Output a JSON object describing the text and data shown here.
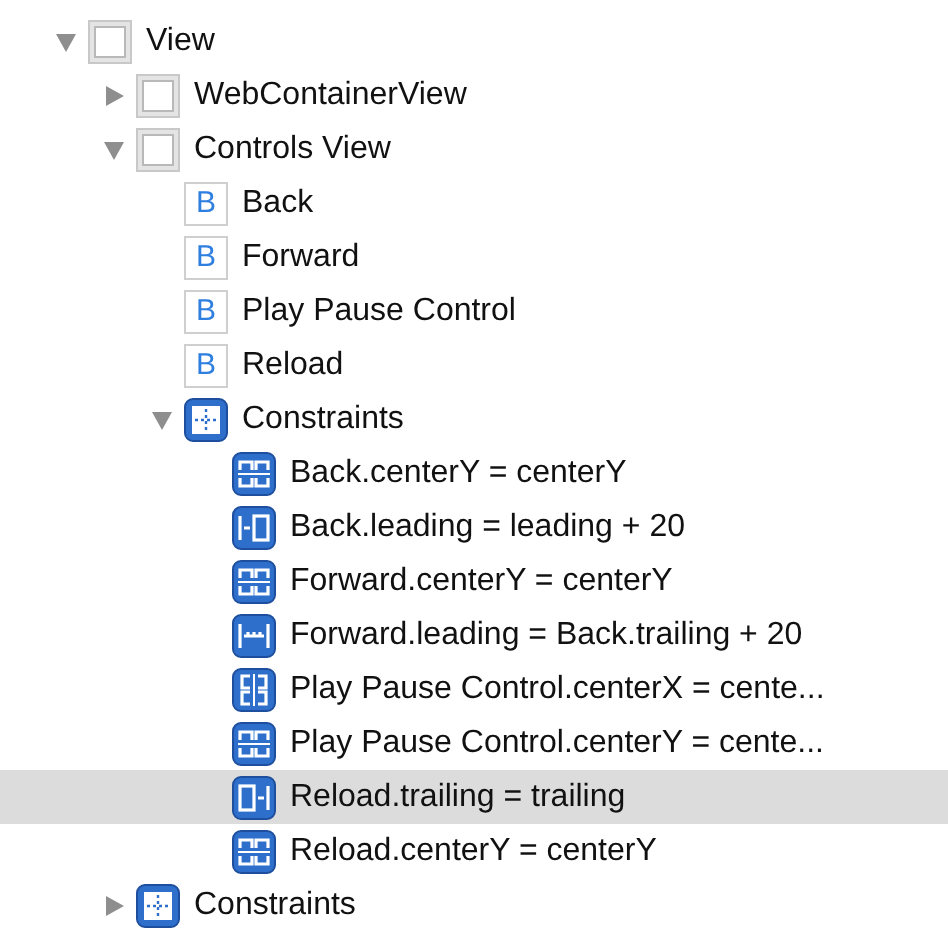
{
  "tree": [
    {
      "label": "View",
      "kind": "view",
      "expanded": true,
      "selected": false,
      "children": [
        {
          "label": "WebContainerView",
          "kind": "view",
          "expanded": false,
          "selected": false
        },
        {
          "label": "Controls View",
          "kind": "view",
          "expanded": true,
          "selected": false,
          "children": [
            {
              "label": "Back",
              "kind": "button",
              "badge": "B",
              "selected": false
            },
            {
              "label": "Forward",
              "kind": "button",
              "badge": "B",
              "selected": false
            },
            {
              "label": "Play Pause Control",
              "kind": "button",
              "badge": "B",
              "selected": false
            },
            {
              "label": "Reload",
              "kind": "button",
              "badge": "B",
              "selected": false
            },
            {
              "label": "Constraints",
              "kind": "constraints",
              "expanded": true,
              "selected": false,
              "children": [
                {
                  "label": "Back.centerY = centerY",
                  "kind": "center-y",
                  "selected": false
                },
                {
                  "label": "Back.leading = leading + 20",
                  "kind": "leading",
                  "selected": false
                },
                {
                  "label": "Forward.centerY = centerY",
                  "kind": "center-y",
                  "selected": false
                },
                {
                  "label": "Forward.leading = Back.trailing + 20",
                  "kind": "spacing",
                  "selected": false
                },
                {
                  "label": "Play Pause Control.centerX = cente...",
                  "kind": "center-x",
                  "selected": false
                },
                {
                  "label": "Play Pause Control.centerY = cente...",
                  "kind": "center-y",
                  "selected": false
                },
                {
                  "label": "Reload.trailing = trailing",
                  "kind": "trailing",
                  "selected": true
                },
                {
                  "label": "Reload.centerY = centerY",
                  "kind": "center-y",
                  "selected": false
                }
              ]
            }
          ]
        },
        {
          "label": "Constraints",
          "kind": "constraints",
          "expanded": false,
          "selected": false
        }
      ]
    }
  ]
}
